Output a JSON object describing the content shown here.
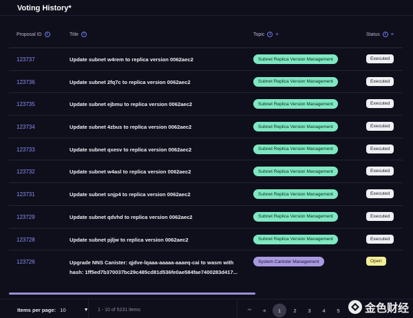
{
  "page": {
    "title": "Voting History*"
  },
  "table": {
    "headers": {
      "proposal_id": "Proposal ID",
      "title": "Title",
      "topic": "Topic",
      "status": "Status"
    },
    "rows": [
      {
        "id": "123737",
        "title": "Update subnet w4rem to replica version 0062aec2",
        "topic": "Subnet Replica Version Management",
        "status": "Executed"
      },
      {
        "id": "123736",
        "title": "Update subnet 2fq7c to replica version 0062aec2",
        "topic": "Subnet Replica Version Management",
        "status": "Executed"
      },
      {
        "id": "123735",
        "title": "Update subnet ejbmu to replica version 0062aec2",
        "topic": "Subnet Replica Version Management",
        "status": "Executed"
      },
      {
        "id": "123734",
        "title": "Update subnet 4zbus to replica version 0062aec2",
        "topic": "Subnet Replica Version Management",
        "status": "Executed"
      },
      {
        "id": "123733",
        "title": "Update subnet qxesv to replica version 0062aec2",
        "topic": "Subnet Replica Version Management",
        "status": "Executed"
      },
      {
        "id": "123732",
        "title": "Update subnet w4asl to replica version 0062aec2",
        "topic": "Subnet Replica Version Management",
        "status": "Executed"
      },
      {
        "id": "123731",
        "title": "Update subnet snjp4 to replica version 0062aec2",
        "topic": "Subnet Replica Version Management",
        "status": "Executed"
      },
      {
        "id": "123729",
        "title": "Update subnet qdvhd to replica version 0062aec2",
        "topic": "Subnet Replica Version Management",
        "status": "Executed"
      },
      {
        "id": "123728",
        "title": "Update subnet pjljw to replica version 0062aec2",
        "topic": "Subnet Replica Version Management",
        "status": "Executed"
      },
      {
        "id": "123726",
        "title": "Upgrade NNS Canister: qjdve-lqaaa-aaaaa-aaaeq-cai to wasm with hash: 1ff5ed7b370037bc29c485cd81d536fe0ae584fae7400283d417...",
        "topic": "System Canister Management",
        "status": "Open"
      }
    ]
  },
  "footer": {
    "items_per_page_label": "Items per page:",
    "items_per_page_value": "10",
    "range_text": "1 - 10 of 5231 items",
    "pages": [
      "1",
      "2",
      "3",
      "4",
      "5"
    ],
    "current_page": "1"
  },
  "watermark": {
    "text": "金色财经"
  },
  "colors": {
    "background": "#0f0f1c",
    "accent": "#8a8ff5",
    "topic_green": "#7fe8c2",
    "topic_purple": "#a99ae0",
    "status_executed": "#eef0f4",
    "status_open": "#f2ee98"
  }
}
